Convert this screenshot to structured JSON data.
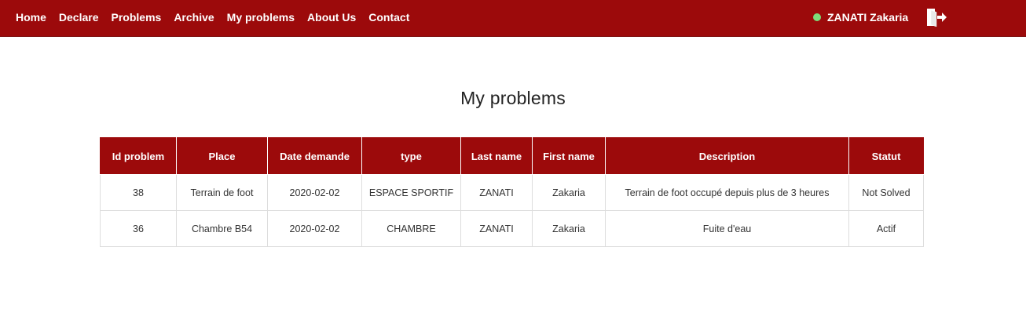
{
  "nav": {
    "links": [
      "Home",
      "Declare",
      "Problems",
      "Archive",
      "My problems",
      "About Us",
      "Contact"
    ],
    "user_name": "ZANATI Zakaria",
    "status_color": "#7ddc7a",
    "logout_icon": "logout-icon"
  },
  "page": {
    "title": "My problems"
  },
  "table": {
    "headers": [
      "Id problem",
      "Place",
      "Date demande",
      "type",
      "Last name",
      "First name",
      "Description",
      "Statut"
    ],
    "rows": [
      [
        "38",
        "Terrain de foot",
        "2020-02-02",
        "ESPACE SPORTIF",
        "ZANATI",
        "Zakaria",
        "Terrain de foot occupé depuis plus de 3 heures",
        "Not Solved"
      ],
      [
        "36",
        "Chambre B54",
        "2020-02-02",
        "CHAMBRE",
        "ZANATI",
        "Zakaria",
        "Fuite d'eau",
        "Actif"
      ]
    ]
  },
  "colors": {
    "brand": "#9c0a0b"
  }
}
